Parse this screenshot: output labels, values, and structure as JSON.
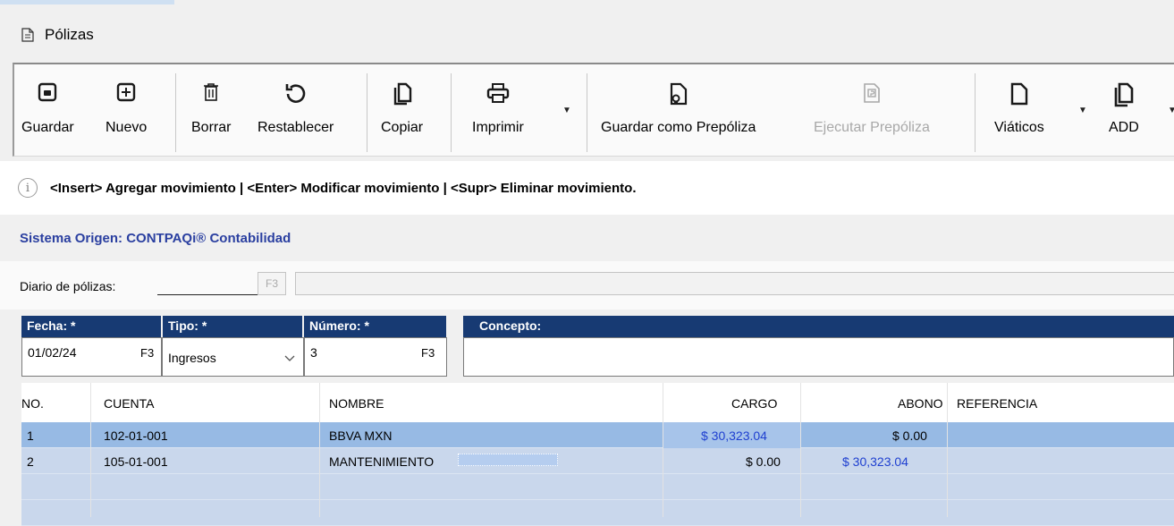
{
  "window": {
    "title": "Pólizas"
  },
  "toolbar": {
    "guardar": "Guardar",
    "nuevo": "Nuevo",
    "borrar": "Borrar",
    "restablecer": "Restablecer",
    "copiar": "Copiar",
    "imprimir": "Imprimir",
    "guardar_prepoliza": "Guardar como Prepóliza",
    "ejecutar_prepoliza": "Ejecutar Prepóliza",
    "viaticos": "Viáticos",
    "add": "ADD"
  },
  "info": {
    "text": "<Insert> Agregar movimiento | <Enter> Modificar movimiento | <Supr> Eliminar movimiento."
  },
  "origin": {
    "text": "Sistema Origen: CONTPAQi® Contabilidad"
  },
  "diario": {
    "label": "Diario de pólizas:",
    "key": "F3",
    "value": ""
  },
  "header": {
    "fecha": {
      "label": "Fecha: *",
      "value": "01/02/24",
      "key": "F3"
    },
    "tipo": {
      "label": "Tipo: *",
      "value": "Ingresos"
    },
    "numero": {
      "label": "Número: *",
      "value": "3",
      "key": "F3"
    },
    "concepto": {
      "label": "Concepto:",
      "value": ""
    }
  },
  "table": {
    "columns": [
      "NO.",
      "CUENTA",
      "NOMBRE",
      "CARGO",
      "ABONO",
      "REFERENCIA"
    ],
    "rows": [
      {
        "no": "1",
        "cuenta": "102-01-001",
        "nombre": "BBVA MXN",
        "cargo": "$ 30,323.04",
        "abono": "$ 0.00",
        "referencia": ""
      },
      {
        "no": "2",
        "cuenta": "105-01-001",
        "nombre": "MANTENIMIENTO",
        "cargo": "$ 0.00",
        "abono": "$ 30,323.04",
        "referencia": ""
      }
    ]
  },
  "colors": {
    "header_bg": "#173a73",
    "row_selected": "#97bae4",
    "row_bg": "#c9d7ec",
    "amount_blue": "#1e3fd0",
    "origin_blue": "#2a3fa0"
  },
  "icons": [
    "document-icon",
    "save-icon",
    "new-icon",
    "delete-icon",
    "restore-icon",
    "copy-icon",
    "print-icon",
    "save-prepoliza-icon",
    "execute-prepoliza-icon",
    "viaticos-icon",
    "add-icon",
    "info-icon"
  ]
}
